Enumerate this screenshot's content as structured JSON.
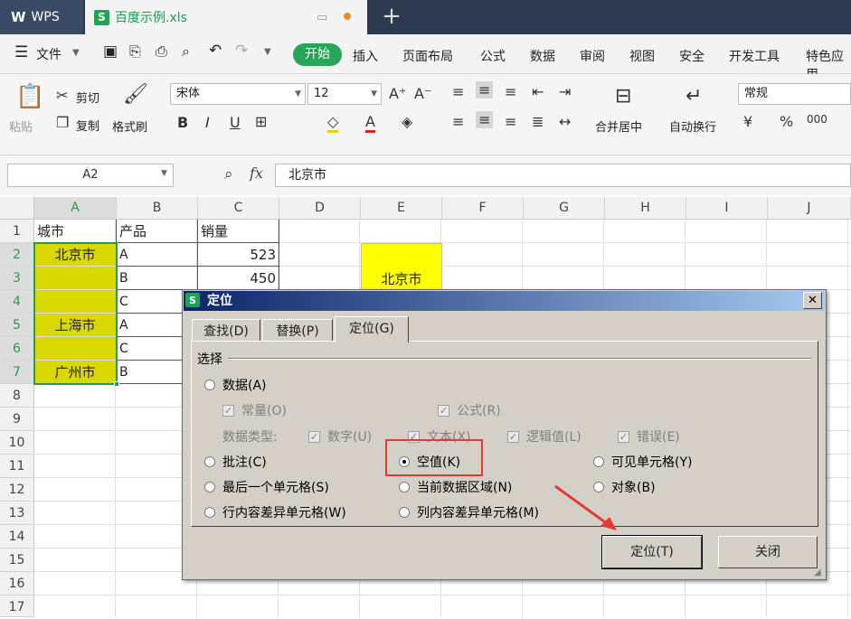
{
  "app": {
    "name": "WPS",
    "doc_tab": "百度示例.xls"
  },
  "menu": {
    "file": "文件",
    "items": [
      "开始",
      "插入",
      "页面布局",
      "公式",
      "数据",
      "审阅",
      "视图",
      "安全",
      "开发工具",
      "特色应用"
    ]
  },
  "ribbon": {
    "paste": "粘贴",
    "cut": "剪切",
    "copy": "复制",
    "format_painter": "格式刷",
    "font_name": "宋体",
    "font_size": "12",
    "merge_center": "合并居中",
    "wrap_text": "自动换行",
    "number_format": "常规"
  },
  "formula_bar": {
    "name_box": "A2",
    "fx": "fx",
    "value": "北京市"
  },
  "sheet": {
    "columns": [
      "A",
      "B",
      "C",
      "D",
      "E",
      "F",
      "G",
      "H",
      "I",
      "J"
    ],
    "rows": [
      "1",
      "2",
      "3",
      "4",
      "5",
      "6",
      "7",
      "8",
      "9",
      "10",
      "11",
      "12",
      "13",
      "14",
      "15",
      "16",
      "17"
    ],
    "cells": {
      "a1": "城市",
      "b1": "产品",
      "c1": "销量",
      "a2": "北京市",
      "b2": "A",
      "c2": "523",
      "b3": "B",
      "c3": "450",
      "b4": "C",
      "a5": "上海市",
      "b5": "A",
      "b6": "C",
      "a7": "广州市",
      "b7": "B",
      "e3": "北京市"
    },
    "highlight_color": "#d9d900",
    "e_highlight_color": "#ffff00"
  },
  "dialog": {
    "title": "定位",
    "tabs": [
      "查找(D)",
      "替换(P)",
      "定位(G)"
    ],
    "section": "选择",
    "data": "数据(A)",
    "constant": "常量(O)",
    "formula": "公式(R)",
    "data_type_label": "数据类型:",
    "number": "数字(U)",
    "text": "文本(X)",
    "logical": "逻辑值(L)",
    "error": "错误(E)",
    "comments": "批注(C)",
    "blanks": "空值(K)",
    "visible_cells": "可见单元格(Y)",
    "last_cell": "最后一个单元格(S)",
    "current_region": "当前数据区域(N)",
    "objects": "对象(B)",
    "row_differences": "行内容差异单元格(W)",
    "col_differences": "列内容差异单元格(M)",
    "ok_button": "定位(T)",
    "close_button": "关闭"
  }
}
